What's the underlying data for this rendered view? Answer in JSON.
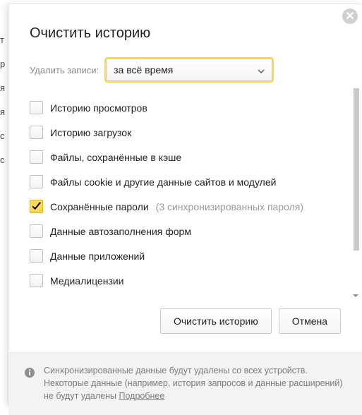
{
  "dialog": {
    "title": "Очистить историю",
    "range_label": "Удалить записи:",
    "range_value": "за всё время"
  },
  "items": [
    {
      "label": "Историю просмотров",
      "checked": false,
      "sub": ""
    },
    {
      "label": "Историю загрузок",
      "checked": false,
      "sub": ""
    },
    {
      "label": "Файлы, сохранённые в кэше",
      "checked": false,
      "sub": ""
    },
    {
      "label": "Файлы cookie и другие данные сайтов и модулей",
      "checked": false,
      "sub": ""
    },
    {
      "label": "Сохранённые пароли",
      "checked": true,
      "sub": "(3 синхронизированных пароля)"
    },
    {
      "label": "Данные автозаполнения форм",
      "checked": false,
      "sub": ""
    },
    {
      "label": "Данные приложений",
      "checked": false,
      "sub": ""
    },
    {
      "label": "Медиалицензии",
      "checked": false,
      "sub": ""
    }
  ],
  "actions": {
    "clear": "Очистить историю",
    "cancel": "Отмена"
  },
  "footer": {
    "text_before": "Синхронизированные данные будут удалены со всех устройств. Некоторые данные (например, история запросов и данные расширений) не будут удалены ",
    "link": "Подробнее"
  }
}
